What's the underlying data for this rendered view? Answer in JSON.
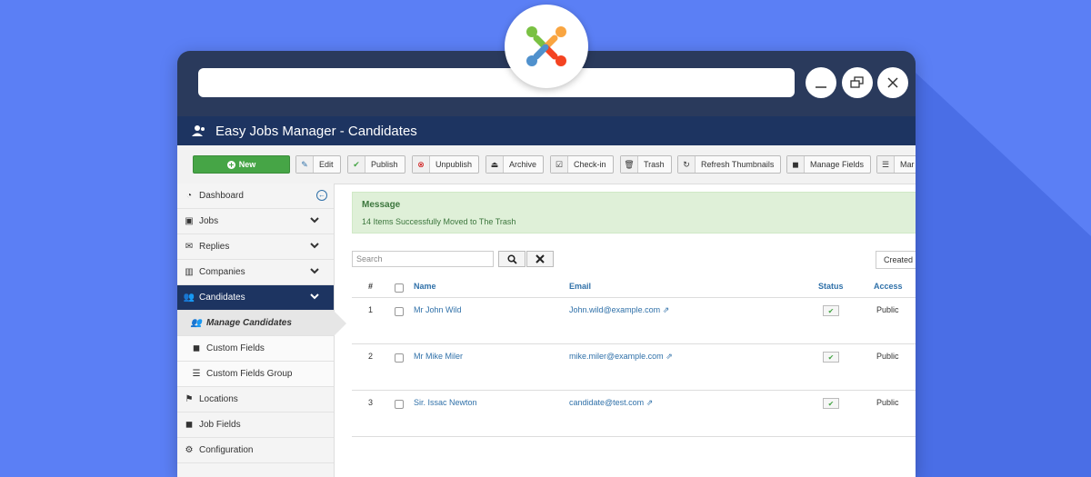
{
  "app": {
    "title": "Easy Jobs Manager - Candidates"
  },
  "toolbar": {
    "new": "New",
    "edit": "Edit",
    "publish": "Publish",
    "unpublish": "Unpublish",
    "archive": "Archive",
    "checkin": "Check-in",
    "trash": "Trash",
    "refresh": "Refresh Thumbnails",
    "manage_fields": "Manage Fields",
    "more": "Mar"
  },
  "sidebar": {
    "items": [
      {
        "label": "Dashboard",
        "icon": "dashboard-icon"
      },
      {
        "label": "Jobs",
        "icon": "briefcase-icon"
      },
      {
        "label": "Replies",
        "icon": "envelope-icon"
      },
      {
        "label": "Companies",
        "icon": "building-icon"
      },
      {
        "label": "Candidates",
        "icon": "users-icon"
      },
      {
        "label": "Manage Candidates",
        "icon": "users-icon"
      },
      {
        "label": "Custom Fields",
        "icon": "cube-icon"
      },
      {
        "label": "Custom Fields Group",
        "icon": "list-icon"
      },
      {
        "label": "Locations",
        "icon": "map-marker-icon"
      },
      {
        "label": "Job Fields",
        "icon": "cube-icon"
      },
      {
        "label": "Configuration",
        "icon": "gear-icon"
      }
    ]
  },
  "message": {
    "heading": "Message",
    "body": "14 Items Successfully Moved to The Trash"
  },
  "search": {
    "placeholder": "Search"
  },
  "sort": {
    "label": "Created"
  },
  "table": {
    "headers": {
      "num": "#",
      "name": "Name",
      "email": "Email",
      "status": "Status",
      "access": "Access"
    },
    "rows": [
      {
        "num": "1",
        "name": "Mr John Wild",
        "email": "John.wild@example.com",
        "access": "Public"
      },
      {
        "num": "2",
        "name": "Mr Mike Miler",
        "email": "mike.miler@example.com",
        "access": "Public"
      },
      {
        "num": "3",
        "name": "Sir. Issac Newton",
        "email": "candidate@test.com",
        "access": "Public"
      }
    ]
  },
  "colors": {
    "background": "#5b7ff5",
    "window_frame": "#2a3a5c",
    "header": "#1d3461",
    "new_button": "#46a546",
    "message_bg": "#dff0d8",
    "link": "#3071a9"
  }
}
